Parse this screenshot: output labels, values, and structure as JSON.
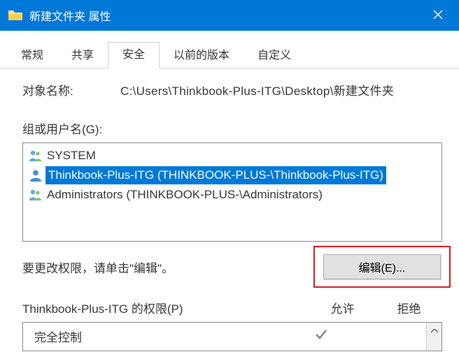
{
  "window": {
    "title": "新建文件夹 属性"
  },
  "tabs": {
    "general": "常规",
    "share": "共享",
    "security": "安全",
    "previous": "以前的版本",
    "custom": "自定义"
  },
  "security": {
    "object_label": "对象名称:",
    "object_path": "C:\\Users\\Thinkbook-Plus-ITG\\Desktop\\新建文件夹",
    "groups_label": "组或用户名(G):",
    "principals": [
      {
        "name": "SYSTEM",
        "type": "group",
        "selected": false
      },
      {
        "name": "Thinkbook-Plus-ITG (THINKBOOK-PLUS-\\Thinkbook-Plus-ITG)",
        "type": "user",
        "selected": true
      },
      {
        "name": "Administrators (THINKBOOK-PLUS-\\Administrators)",
        "type": "group",
        "selected": false
      }
    ],
    "edit_hint": "要更改权限，请单击\"编辑\"。",
    "edit_button": "编辑(E)...",
    "perm_title": "Thinkbook-Plus-ITG 的权限(P)",
    "col_allow": "允许",
    "col_deny": "拒绝",
    "perms": [
      {
        "name": "完全控制",
        "allow": true,
        "deny": false
      }
    ]
  }
}
